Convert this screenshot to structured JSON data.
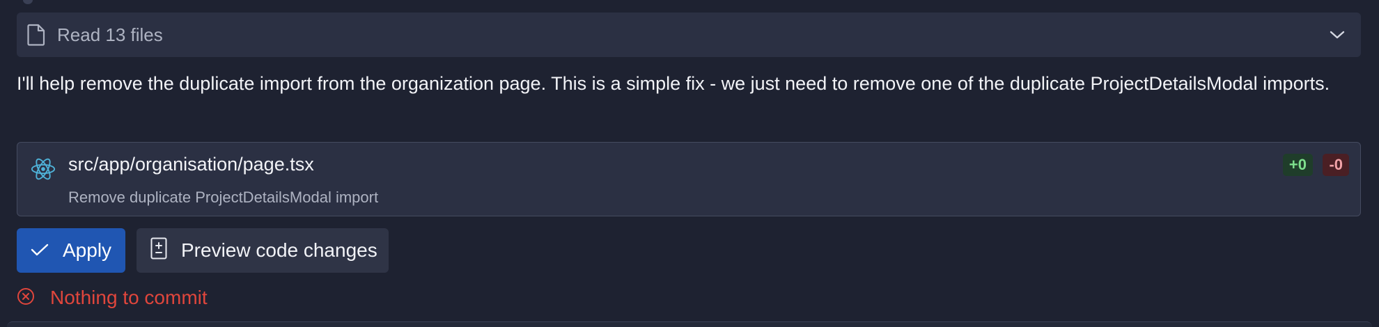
{
  "read_files": {
    "label": "Read 13 files",
    "icon": "file-icon"
  },
  "message": {
    "text": "I'll help remove the duplicate import from the organization page. This is a simple fix - we just need to remove one of the duplicate ProjectDetailsModal imports."
  },
  "file_change": {
    "icon": "react-icon",
    "path": "src/app/organisation/page.tsx",
    "description": "Remove duplicate ProjectDetailsModal import",
    "additions": "+0",
    "deletions": "-0"
  },
  "actions": {
    "apply_label": "Apply",
    "preview_label": "Preview code changes"
  },
  "status": {
    "text": "Nothing to commit",
    "icon": "x-circle-icon"
  },
  "colors": {
    "background": "#1e2231",
    "panel": "#2b3043",
    "apply_button": "#2056b2",
    "error": "#e0463c",
    "additions": "#7ee08d",
    "deletions": "#f2a3a8",
    "react_accent": "#4fb3d9"
  }
}
